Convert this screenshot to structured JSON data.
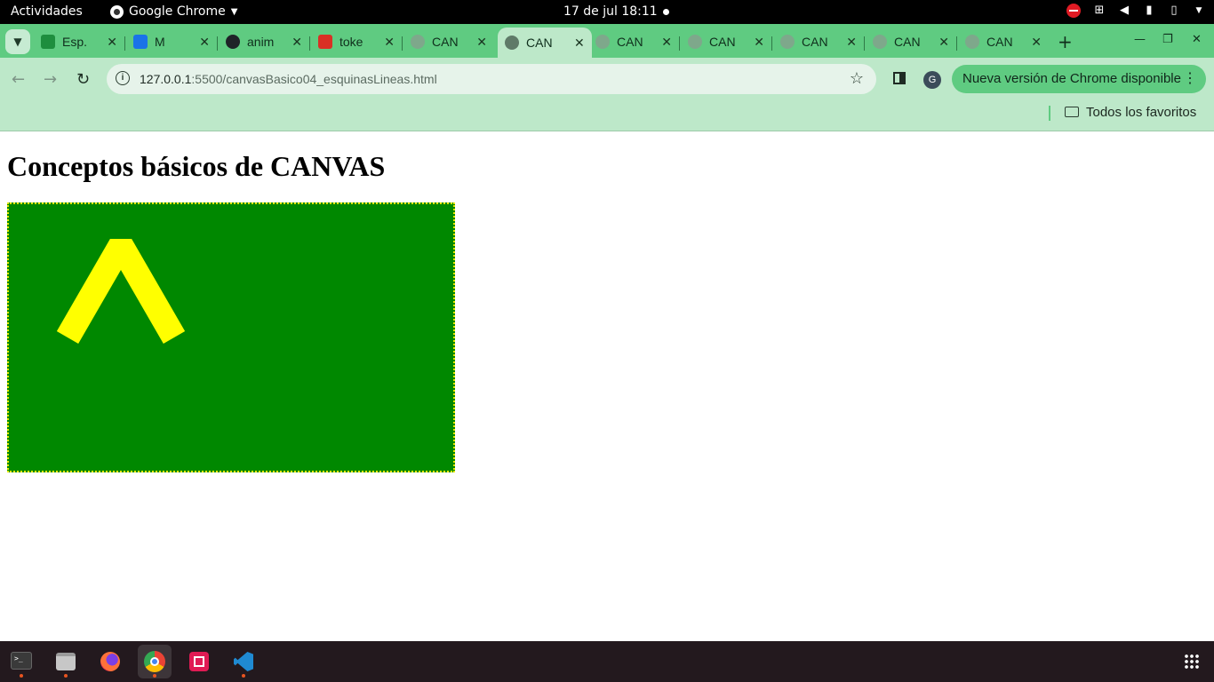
{
  "system_bar": {
    "activities": "Actividades",
    "app_name": "Google Chrome",
    "clock": "17 de jul  18:11"
  },
  "tabs": [
    {
      "title": "Esp.",
      "favicon": "contacts-icon",
      "color": "#1e8e3e"
    },
    {
      "title": "M",
      "favicon": "meet-icon",
      "color": "#1a73e8"
    },
    {
      "title": "anim",
      "favicon": "github-icon",
      "color": "#1f2328"
    },
    {
      "title": "toke",
      "favicon": "gmail-icon",
      "color": "#d93025"
    },
    {
      "title": "CAN",
      "favicon": "globe-icon",
      "color": "#7ea88b"
    },
    {
      "title": "CAN",
      "favicon": "globe-icon",
      "color": "#5f7a68",
      "active": true
    },
    {
      "title": "CAN",
      "favicon": "globe-icon",
      "color": "#7ea88b"
    },
    {
      "title": "CAN",
      "favicon": "globe-icon",
      "color": "#7ea88b"
    },
    {
      "title": "CAN",
      "favicon": "globe-icon",
      "color": "#7ea88b"
    },
    {
      "title": "CAN",
      "favicon": "globe-icon",
      "color": "#7ea88b"
    },
    {
      "title": "CAN",
      "favicon": "globe-icon",
      "color": "#7ea88b"
    }
  ],
  "toolbar": {
    "url_host": "127.0.0.1",
    "url_rest": ":5500/canvasBasico04_esquinasLineas.html",
    "profile_initial": "G",
    "update_label": "Nueva versión de Chrome disponible"
  },
  "bookmarks": {
    "all_bookmarks": "Todos los favoritos"
  },
  "page": {
    "heading": "Conceptos básicos de CANVAS",
    "canvas": {
      "background": "#008800",
      "border_color": "#e8e800",
      "stroke_color": "#ffff00",
      "shape": "bevel-joined chevron line"
    }
  },
  "dock": {
    "apps": [
      "terminal-icon",
      "files-icon",
      "firefox-icon",
      "chrome-icon",
      "screenshot-icon",
      "vscode-icon"
    ]
  }
}
